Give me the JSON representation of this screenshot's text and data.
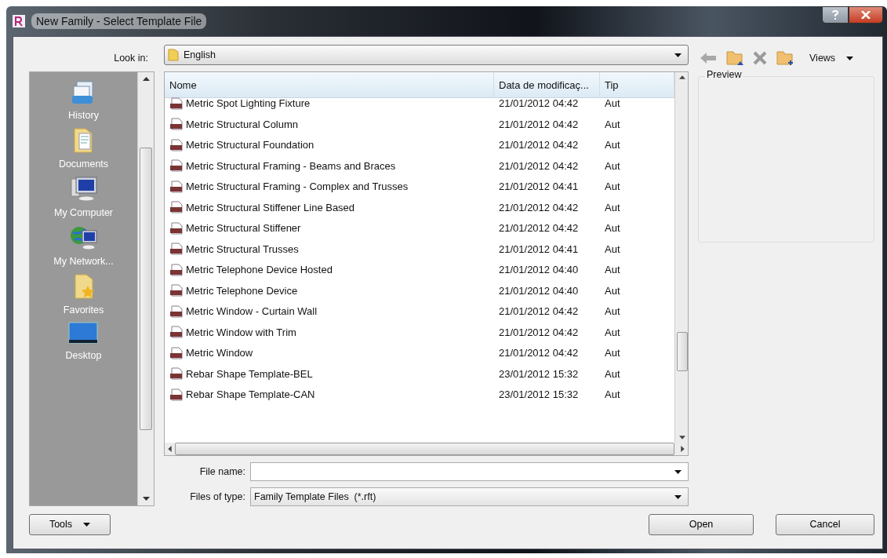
{
  "window": {
    "title": "New Family - Select Template File"
  },
  "look_in": {
    "label": "Look in:",
    "value": "English"
  },
  "toolbar": {
    "views": "Views"
  },
  "places": [
    {
      "label": "History",
      "kind": "history"
    },
    {
      "label": "Documents",
      "kind": "documents"
    },
    {
      "label": "My Computer",
      "kind": "computer"
    },
    {
      "label": "My Network...",
      "kind": "network"
    },
    {
      "label": "Favorites",
      "kind": "favorites"
    },
    {
      "label": "Desktop",
      "kind": "desktop"
    }
  ],
  "table": {
    "columns": [
      "Nome",
      "Data de modificaç...",
      "Tip"
    ],
    "rows": [
      {
        "name": "Metric Spot Lighting Fixture",
        "date": "21/01/2012 04:42",
        "type": "Aut"
      },
      {
        "name": "Metric Structural Column",
        "date": "21/01/2012 04:42",
        "type": "Aut"
      },
      {
        "name": "Metric Structural Foundation",
        "date": "21/01/2012 04:42",
        "type": "Aut"
      },
      {
        "name": "Metric Structural Framing - Beams and Braces",
        "date": "21/01/2012 04:42",
        "type": "Aut"
      },
      {
        "name": "Metric Structural Framing - Complex and Trusses",
        "date": "21/01/2012 04:41",
        "type": "Aut"
      },
      {
        "name": "Metric Structural Stiffener Line Based",
        "date": "21/01/2012 04:42",
        "type": "Aut"
      },
      {
        "name": "Metric Structural Stiffener",
        "date": "21/01/2012 04:42",
        "type": "Aut"
      },
      {
        "name": "Metric Structural Trusses",
        "date": "21/01/2012 04:41",
        "type": "Aut"
      },
      {
        "name": "Metric Telephone Device Hosted",
        "date": "21/01/2012 04:40",
        "type": "Aut"
      },
      {
        "name": "Metric Telephone Device",
        "date": "21/01/2012 04:40",
        "type": "Aut"
      },
      {
        "name": "Metric Window - Curtain Wall",
        "date": "21/01/2012 04:42",
        "type": "Aut"
      },
      {
        "name": "Metric Window with Trim",
        "date": "21/01/2012 04:42",
        "type": "Aut"
      },
      {
        "name": "Metric Window",
        "date": "21/01/2012 04:42",
        "type": "Aut"
      },
      {
        "name": "Rebar Shape Template-BEL",
        "date": "23/01/2012 15:32",
        "type": "Aut"
      },
      {
        "name": "Rebar Shape Template-CAN",
        "date": "23/01/2012 15:32",
        "type": "Aut"
      }
    ]
  },
  "preview": {
    "label": "Preview"
  },
  "file_name": {
    "label": "File name:"
  },
  "file_type": {
    "label": "Files of type:",
    "value": "Family Template Files  (*.rft)"
  },
  "buttons": {
    "tools": "Tools",
    "open": "Open",
    "cancel": "Cancel"
  }
}
